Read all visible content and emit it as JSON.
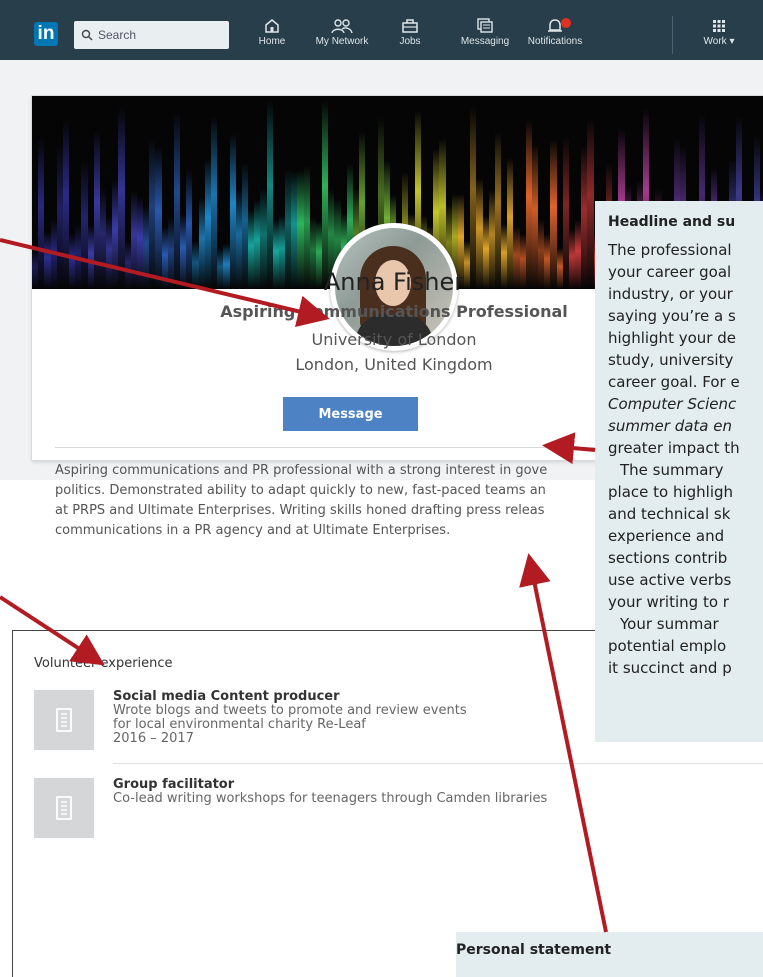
{
  "nav": {
    "search_placeholder": "Search",
    "items": [
      {
        "label": "Home",
        "icon": "home-icon"
      },
      {
        "label": "My Network",
        "icon": "network-icon"
      },
      {
        "label": "Jobs",
        "icon": "briefcase-icon"
      },
      {
        "label": "Messaging",
        "icon": "messaging-icon"
      },
      {
        "label": "Notifications",
        "icon": "bell-icon"
      },
      {
        "label": "Work ▾",
        "icon": "grid-icon"
      }
    ],
    "logo": "in"
  },
  "profile": {
    "name": "Anna Fisher",
    "headline": "Aspiring Communications Professional",
    "school": "University of London",
    "location": "London, United Kingdom",
    "message_label": "Message",
    "summary_lines": [
      "Aspiring communications and PR professional with a strong interest in gove",
      "politics. Demonstrated ability to adapt quickly to new, fast-paced teams an",
      "at PRPS and Ultimate Enterprises. Writing skills honed drafting press releas",
      "communications in a PR agency and at Ultimate Enterprises."
    ]
  },
  "volunteer": {
    "title": "Volunteer experience",
    "items": [
      {
        "role": "Social media Content producer",
        "lines": [
          "Wrote blogs and tweets to promote and review events",
          "for local environmental charity Re-Leaf",
          "2016 – 2017"
        ]
      },
      {
        "role": "Group facilitator",
        "lines": [
          "Co-lead writing workshops for teenagers through Camden libraries"
        ]
      }
    ]
  },
  "notes": {
    "headline_summary": {
      "title": "Headline and su",
      "lines": [
        {
          "text": "The professional",
          "style": ""
        },
        {
          "text": "your career goal",
          "style": ""
        },
        {
          "text": "industry, or your",
          "style": ""
        },
        {
          "text": "saying you’re a s",
          "style": ""
        },
        {
          "text": "highlight your de",
          "style": ""
        },
        {
          "text": "study, university",
          "style": ""
        },
        {
          "text": "career goal. For e",
          "style": ""
        },
        {
          "text": "Computer Scienc",
          "style": "it"
        },
        {
          "text": "summer data en",
          "style": "it"
        },
        {
          "text": "greater impact th",
          "style": ""
        },
        {
          "text": "The summary",
          "style": "ind"
        },
        {
          "text": "place to highligh",
          "style": ""
        },
        {
          "text": "and technical sk",
          "style": ""
        },
        {
          "text": "experience and",
          "style": ""
        },
        {
          "text": "sections contrib",
          "style": ""
        },
        {
          "text": "use active verbs",
          "style": ""
        },
        {
          "text": "your writing to r",
          "style": ""
        },
        {
          "text": "Your summar",
          "style": "ind"
        },
        {
          "text": "potential emplo",
          "style": ""
        },
        {
          "text": "it succinct and p",
          "style": ""
        }
      ]
    },
    "personal_statement": {
      "title": "Personal statement"
    }
  },
  "colors": {
    "nav_bg": "#283e4a",
    "brand": "#0077b5",
    "button": "#4d82c4",
    "arrow": "#b31b22",
    "note_bg": "#e3ecef"
  }
}
